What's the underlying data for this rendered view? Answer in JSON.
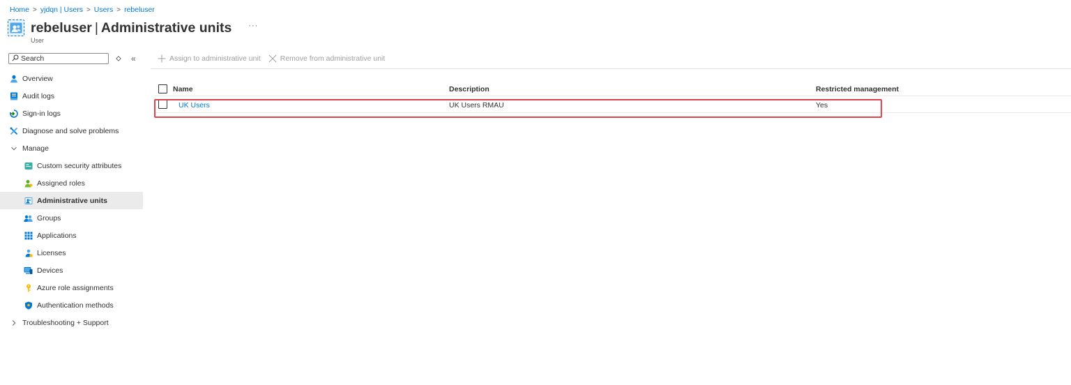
{
  "breadcrumb": {
    "items": [
      "Home",
      "yjdqn | Users",
      "Users",
      "rebeluser"
    ]
  },
  "header": {
    "title_strong": "rebeluser",
    "title_separator": "|",
    "title_rest": "Administrative units",
    "subtitle": "User",
    "more_label": "···",
    "icon": "admin-unit-icon"
  },
  "sidebar": {
    "search_placeholder": "Search",
    "collapse_label": "«",
    "items": [
      {
        "label": "Overview",
        "icon": "user-icon"
      },
      {
        "label": "Audit logs",
        "icon": "audit-log-icon"
      },
      {
        "label": "Sign-in logs",
        "icon": "sign-in-icon"
      },
      {
        "label": "Diagnose and solve problems",
        "icon": "wrench-icon"
      },
      {
        "label": "Manage",
        "icon": "chevron-down-icon"
      },
      {
        "label": "Custom security attributes",
        "icon": "attributes-icon"
      },
      {
        "label": "Assigned roles",
        "icon": "role-icon"
      },
      {
        "label": "Administrative units",
        "icon": "admin-unit-icon"
      },
      {
        "label": "Groups",
        "icon": "group-icon"
      },
      {
        "label": "Applications",
        "icon": "apps-grid-icon"
      },
      {
        "label": "Licenses",
        "icon": "license-icon"
      },
      {
        "label": "Devices",
        "icon": "device-icon"
      },
      {
        "label": "Azure role assignments",
        "icon": "key-icon"
      },
      {
        "label": "Authentication methods",
        "icon": "shield-icon"
      },
      {
        "label": "Troubleshooting + Support",
        "icon": "chevron-right-icon"
      }
    ]
  },
  "toolbar": {
    "assign_label": "Assign to administrative unit",
    "remove_label": "Remove from administrative unit"
  },
  "table": {
    "columns": [
      "Name",
      "Description",
      "Restricted management"
    ],
    "rows": [
      {
        "name": "UK Users",
        "description": "UK Users RMAU",
        "restricted": "Yes"
      }
    ]
  },
  "colors": {
    "accent": "#0078d4",
    "highlight": "#e0434b",
    "selected_bg": "#ebebeb"
  }
}
